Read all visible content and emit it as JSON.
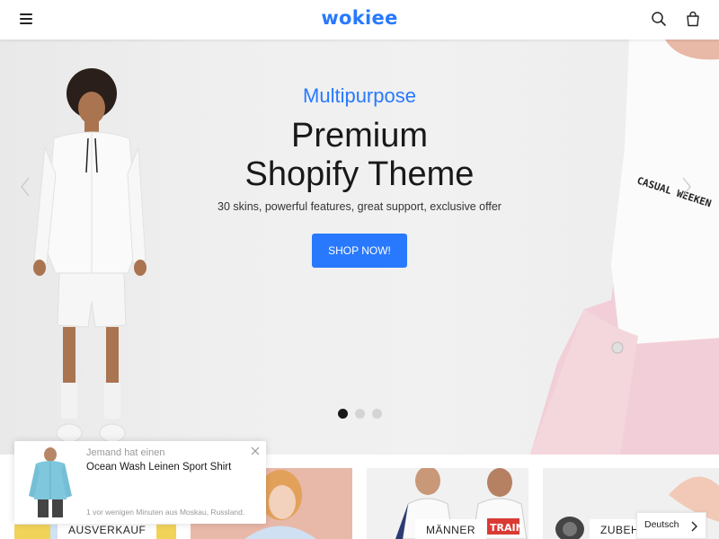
{
  "header": {
    "logo": "wokiee",
    "menu_icon": "hamburger-menu-icon",
    "search_icon": "search-icon",
    "cart_icon": "shopping-bag-icon"
  },
  "hero": {
    "subtitle": "Multipurpose",
    "title_line1": "Premium",
    "title_line2": "Shopify Theme",
    "description": "30 skins, powerful features, great support, exclusive offer",
    "button_label": "SHOP NOW!",
    "slides_total": 3,
    "active_slide": 1,
    "accent_color": "#2879fe"
  },
  "categories": [
    {
      "label": "AUSVERKAUF"
    },
    {
      "label": ""
    },
    {
      "label": "MÄNNER"
    },
    {
      "label": "ZUBEHÖR"
    }
  ],
  "popup": {
    "top_text": "Jemand hat einen",
    "product": "Ocean Wash Leinen Sport Shirt",
    "meta": "1 vor wenigen Minuten aus Moskau, Russland."
  },
  "language": {
    "label": "Deutsch"
  }
}
